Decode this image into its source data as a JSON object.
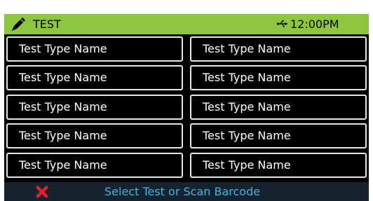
{
  "header": {
    "title": "TEST",
    "time": "12:00PM",
    "icons": {
      "left": "pen-icon",
      "usb": "usb-icon"
    },
    "color": "#8dc63f"
  },
  "tests": {
    "left": [
      "Test Type Name",
      "Test Type Name",
      "Test Type Name",
      "Test Type Name",
      "Test Type Name"
    ],
    "right": [
      "Test Type Name",
      "Test Type Name",
      "Test Type Name",
      "Test Type Name",
      "Test Type Name"
    ]
  },
  "status": {
    "message": "Select Test or Scan Barcode",
    "icon": "close-icon",
    "message_color": "#3db3e8",
    "icon_color": "#e0202a"
  }
}
